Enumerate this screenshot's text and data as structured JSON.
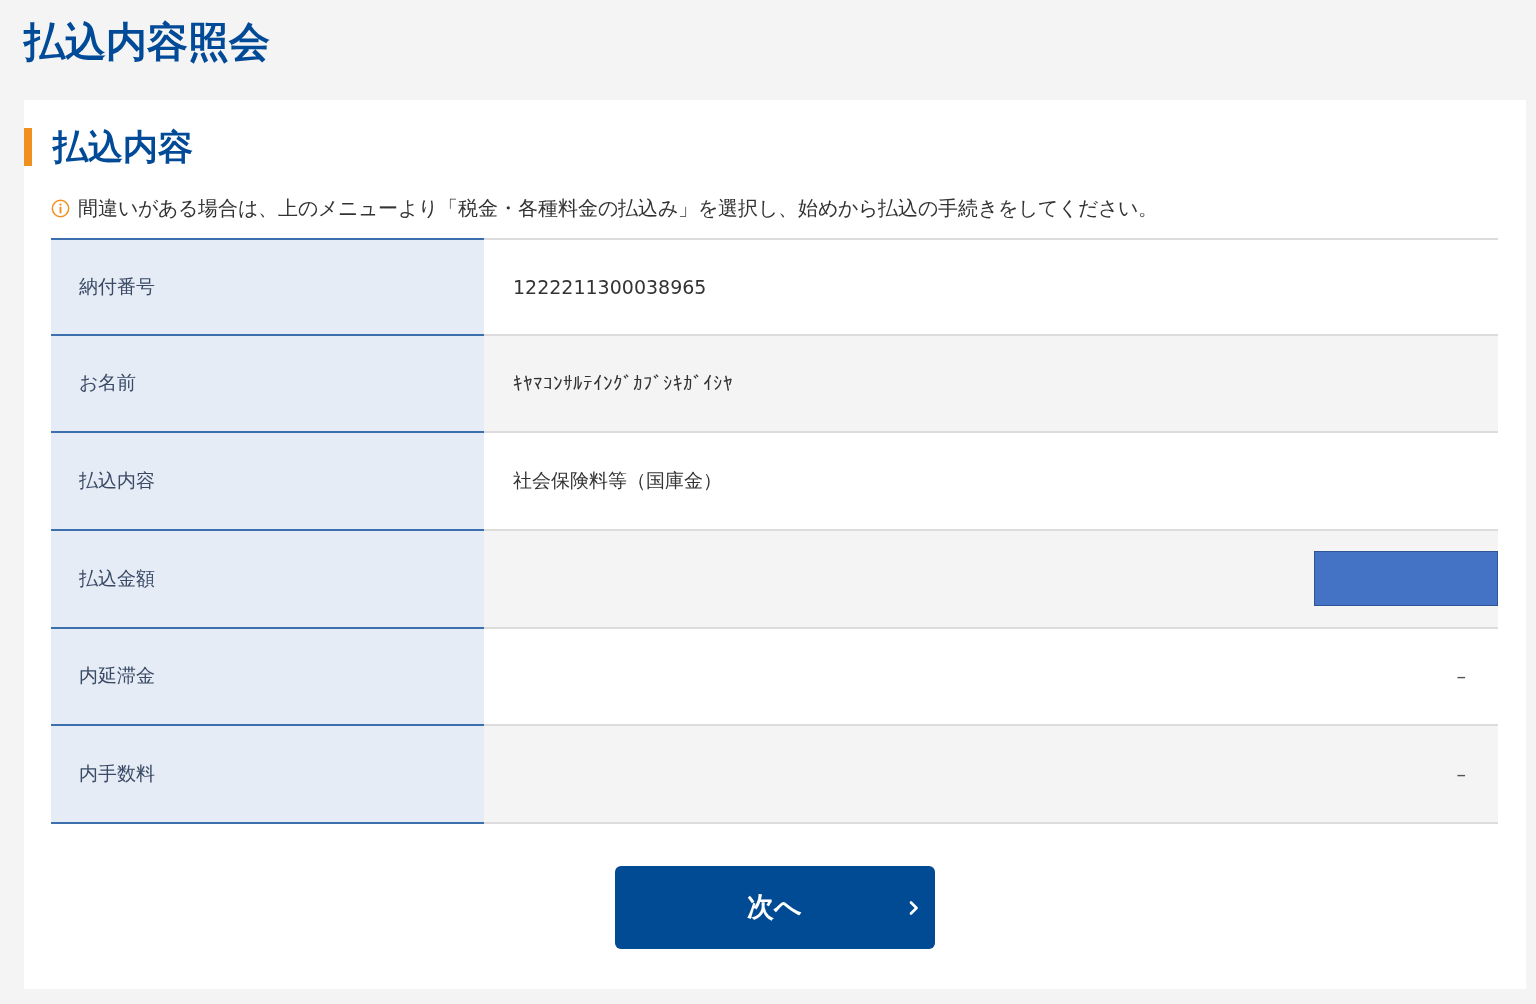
{
  "page_title": "払込内容照会",
  "section": {
    "title": "払込内容",
    "notice": "間違いがある場合は、上のメニューより「税金・各種料金の払込み」を選択し、始めから払込の手続きをしてください。"
  },
  "rows": [
    {
      "label": "納付番号",
      "kind": "text",
      "value": "1222211300038965"
    },
    {
      "label": "お名前",
      "kind": "text",
      "value": "ｷﾔﾏｺﾝｻﾙﾃｲﾝｸﾞｶﾌﾞｼｷｶﾞｲｼﾔ"
    },
    {
      "label": "払込内容",
      "kind": "text",
      "value": "社会保険料等（国庫金）"
    },
    {
      "label": "払込金額",
      "kind": "amount",
      "redacted": true
    },
    {
      "label": "内延滞金",
      "kind": "amount",
      "value": "–"
    },
    {
      "label": "内手数料",
      "kind": "amount",
      "value": "–"
    }
  ],
  "button": {
    "label": "次へ"
  }
}
